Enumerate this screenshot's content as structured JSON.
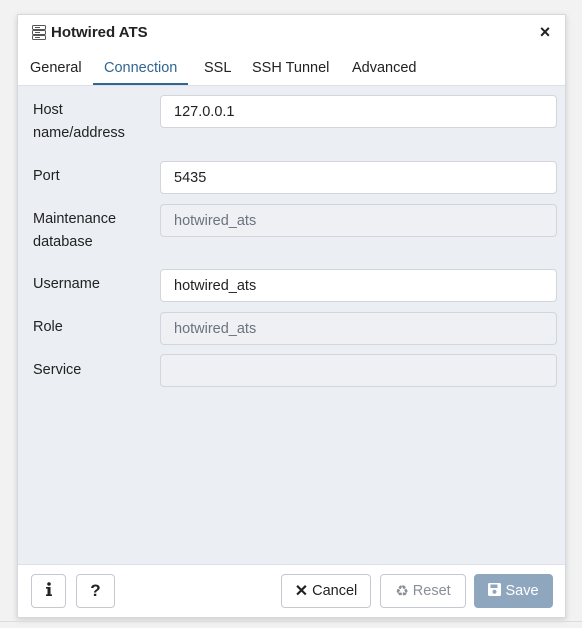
{
  "dialog": {
    "title": "Hotwired ATS",
    "title_icon": "server-icon",
    "close_label": "×"
  },
  "tabs": [
    {
      "label": "General",
      "active": false
    },
    {
      "label": "Connection",
      "active": true
    },
    {
      "label": "SSL",
      "active": false
    },
    {
      "label": "SSH Tunnel",
      "active": false
    },
    {
      "label": "Advanced",
      "active": false
    }
  ],
  "form": {
    "host": {
      "label_line1": "Host",
      "label_line2": "name/address",
      "value": "127.0.0.1"
    },
    "port": {
      "label": "Port",
      "value": "5435"
    },
    "maintenance_db": {
      "label_line1": "Maintenance",
      "label_line2": "database",
      "value": "hotwired_ats",
      "disabled": true
    },
    "username": {
      "label": "Username",
      "value": "hotwired_ats"
    },
    "role": {
      "label": "Role",
      "value": "hotwired_ats",
      "disabled": true
    },
    "service": {
      "label": "Service",
      "value": "",
      "disabled": true
    }
  },
  "footer": {
    "info_icon": "info-icon",
    "help_label": "?",
    "cancel_label": "Cancel",
    "reset_label": "Reset",
    "save_label": "Save"
  },
  "colors": {
    "accent": "#326690",
    "save_button": "#8fa6bf",
    "dialog_bg": "#ebeef3"
  }
}
